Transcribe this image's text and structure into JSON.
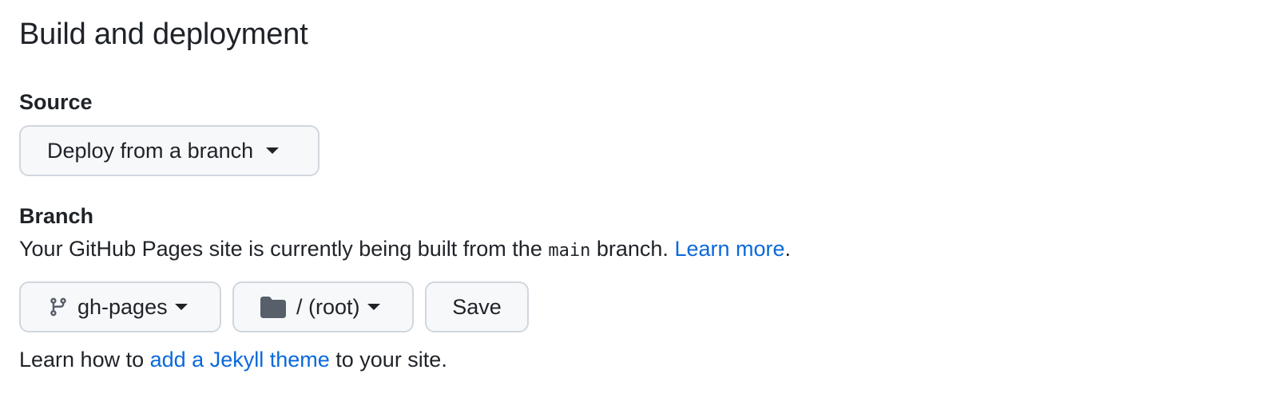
{
  "section": {
    "title": "Build and deployment"
  },
  "source": {
    "label": "Source",
    "selected": "Deploy from a branch"
  },
  "branch": {
    "label": "Branch",
    "description_prefix": "Your GitHub Pages site is currently being built from the",
    "branch_code": "main",
    "description_suffix": "branch.",
    "learn_more": "Learn more",
    "period": ".",
    "branch_select": "gh-pages",
    "folder_select": "/ (root)",
    "save_label": "Save"
  },
  "footer": {
    "prefix": "Learn how to",
    "link": "add a Jekyll theme",
    "suffix": "to your site."
  },
  "colors": {
    "link": "#0969da",
    "button_bg": "#f6f8fa",
    "button_border": "#d0d7de",
    "text": "#1f2328",
    "icon": "#57606a"
  },
  "icons": {
    "branch_icon": "git-branch-icon",
    "folder_icon": "folder-icon",
    "dropdown_icon": "triangle-down-icon"
  }
}
